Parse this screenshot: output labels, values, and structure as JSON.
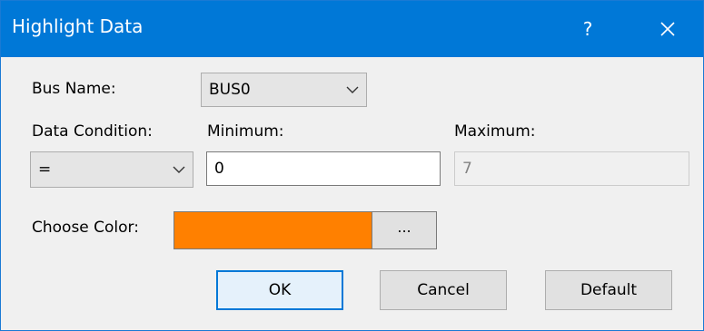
{
  "window": {
    "title": "Highlight Data",
    "help_label": "?",
    "accent_color": "#0078d7"
  },
  "bus": {
    "label": "Bus Name:",
    "value": "BUS0"
  },
  "condition": {
    "label": "Data Condition:",
    "value": "="
  },
  "minimum": {
    "label": "Minimum:",
    "value": "0"
  },
  "maximum": {
    "label": "Maximum:",
    "value": "7"
  },
  "color": {
    "label": "Choose Color:",
    "swatch": "#ff8000",
    "browse_label": "..."
  },
  "buttons": {
    "ok": "OK",
    "cancel": "Cancel",
    "default": "Default"
  }
}
